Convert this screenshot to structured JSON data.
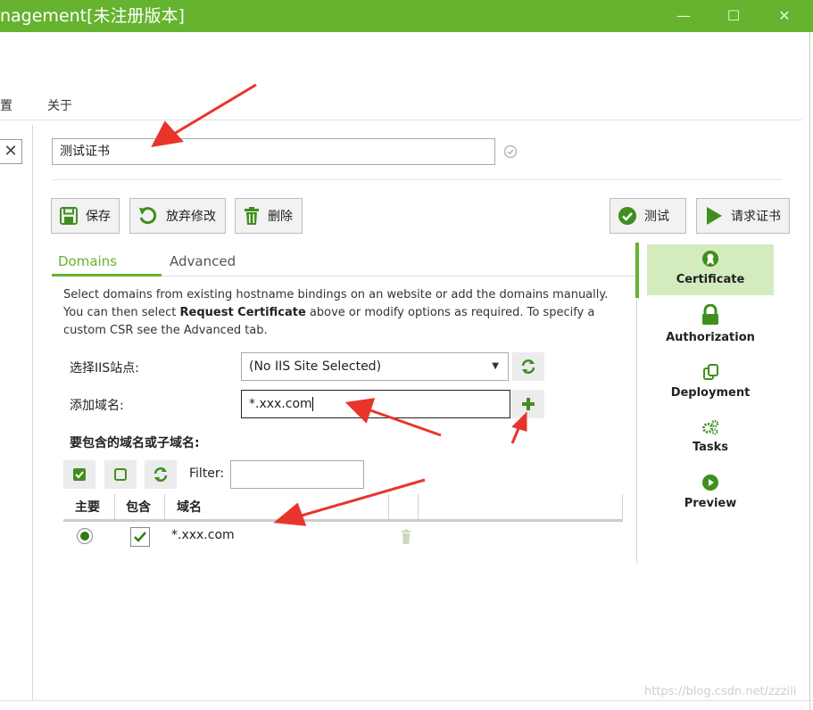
{
  "window": {
    "title": "nagement[未注册版本]",
    "minimize": "—",
    "maximize": "☐",
    "close": "✕"
  },
  "menu": [
    "置",
    "关于"
  ],
  "certificate_name": "测试证书",
  "toolbar": {
    "save": "保存",
    "discard": "放弃修改",
    "delete": "删除",
    "test": "测试",
    "request": "请求证书"
  },
  "tabs": [
    "Domains",
    "Advanced"
  ],
  "description": {
    "part1": "Select domains from existing hostname bindings on an website or add the domains manually. You can then select ",
    "bold": "Request Certificate",
    "part2": " above or modify options as required. To specify a custom CSR see the Advanced tab."
  },
  "form": {
    "site_label": "选择IIS站点:",
    "site_value": "(No IIS Site Selected)",
    "add_domain_label": "添加域名:",
    "add_domain_value": "*.xxx.com",
    "included_label": "要包含的域名或子域名:",
    "filter_label": "Filter:",
    "filter_value": ""
  },
  "grid": {
    "headers": [
      "主要",
      "包含",
      "域名"
    ],
    "rows": [
      {
        "primary": true,
        "included": true,
        "domain": "*.xxx.com"
      }
    ]
  },
  "sidebar": [
    {
      "label": "Certificate",
      "icon": "certificate-icon",
      "active": true
    },
    {
      "label": "Authorization",
      "icon": "lock-icon",
      "active": false
    },
    {
      "label": "Deployment",
      "icon": "deployment-icon",
      "active": false
    },
    {
      "label": "Tasks",
      "icon": "gears-icon",
      "active": false
    },
    {
      "label": "Preview",
      "icon": "play-circle-icon",
      "active": false
    }
  ],
  "watermark": "https://blog.csdn.net/zzzili",
  "colors": {
    "accent": "#65b32e",
    "active_bg": "#d4ebbe",
    "annotation_arrow": "#e8352c"
  }
}
